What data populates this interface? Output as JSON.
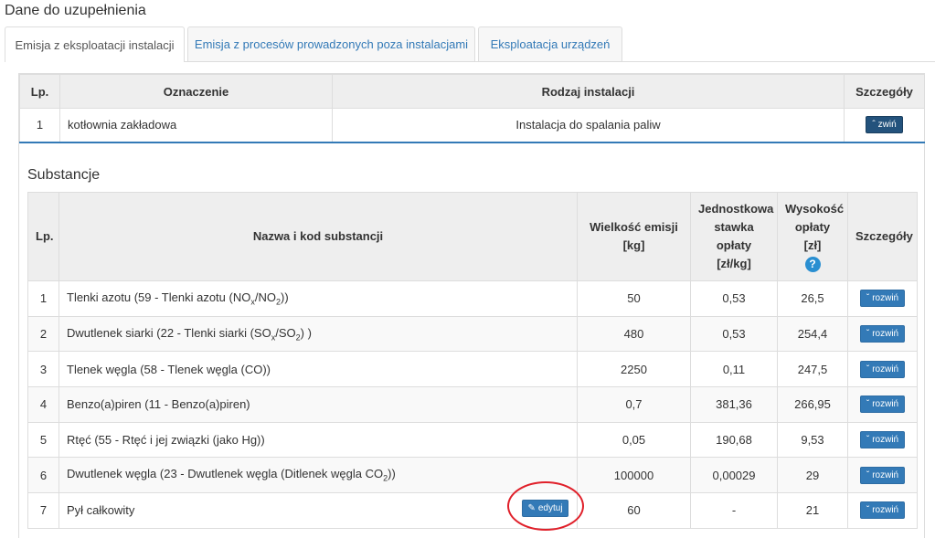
{
  "page": {
    "title": "Dane do uzupełnienia"
  },
  "tabs": [
    {
      "label": "Emisja z eksploatacji instalacji",
      "active": true
    },
    {
      "label": "Emisja z procesów prowadzonych poza instalacjami",
      "active": false
    },
    {
      "label": "Eksploatacja urządzeń",
      "active": false
    }
  ],
  "installations": {
    "headers": {
      "lp": "Lp.",
      "name": "Oznaczenie",
      "type": "Rodzaj instalacji",
      "details": "Szczegóły"
    },
    "rows": [
      {
        "lp": "1",
        "name": "kotłownia zakładowa",
        "type": "Instalacja do spalania paliw",
        "button": "zwiń"
      }
    ]
  },
  "substances": {
    "title": "Substancje",
    "headers": {
      "lp": "Lp.",
      "name": "Nazwa i kod substancji",
      "emission_line1": "Wielkość emisji",
      "emission_line2": "[kg]",
      "rate_line1": "Jednostkowa",
      "rate_line2": "stawka",
      "rate_line3": "opłaty",
      "rate_line4": "[zł/kg]",
      "fee_line1": "Wysokość",
      "fee_line2": "opłaty",
      "fee_line3": "[zł]",
      "details": "Szczegóły",
      "help_glyph": "?"
    },
    "rows": [
      {
        "lp": "1",
        "name_pre": "Tlenki azotu (59 - Tlenki azotu (NO",
        "sub1": "x",
        "name_mid": "/NO",
        "sub2": "2",
        "name_post": "))",
        "emission": "50",
        "rate": "0,53",
        "fee": "26,5",
        "button": "rozwiń"
      },
      {
        "lp": "2",
        "name_pre": "Dwutlenek siarki (22 - Tlenki siarki (SO",
        "sub1": "x",
        "name_mid": "/SO",
        "sub2": "2",
        "name_post": ") )",
        "emission": "480",
        "rate": "0,53",
        "fee": "254,4",
        "button": "rozwiń"
      },
      {
        "lp": "3",
        "name": "Tlenek węgla (58 - Tlenek węgla (CO))",
        "emission": "2250",
        "rate": "0,11",
        "fee": "247,5",
        "button": "rozwiń"
      },
      {
        "lp": "4",
        "name": "Benzo(a)piren (11 - Benzo(a)piren)",
        "emission": "0,7",
        "rate": "381,36",
        "fee": "266,95",
        "button": "rozwiń"
      },
      {
        "lp": "5",
        "name": "Rtęć (55 - Rtęć i jej związki (jako Hg))",
        "emission": "0,05",
        "rate": "190,68",
        "fee": "9,53",
        "button": "rozwiń"
      },
      {
        "lp": "6",
        "name_pre": "Dwutlenek węgla (23 - Dwutlenek węgla (Ditlenek węgla CO",
        "sub2": "2",
        "name_post": "))",
        "emission": "100000",
        "rate": "0,00029",
        "fee": "29",
        "button": "rozwiń"
      },
      {
        "lp": "7",
        "name": "Pył całkowity",
        "edit_button": "edytuj",
        "emission": "60",
        "rate": "-",
        "fee": "21",
        "button": "rozwiń"
      }
    ]
  },
  "colors": {
    "accent": "#337ab7",
    "annotation": "#e0202a"
  }
}
